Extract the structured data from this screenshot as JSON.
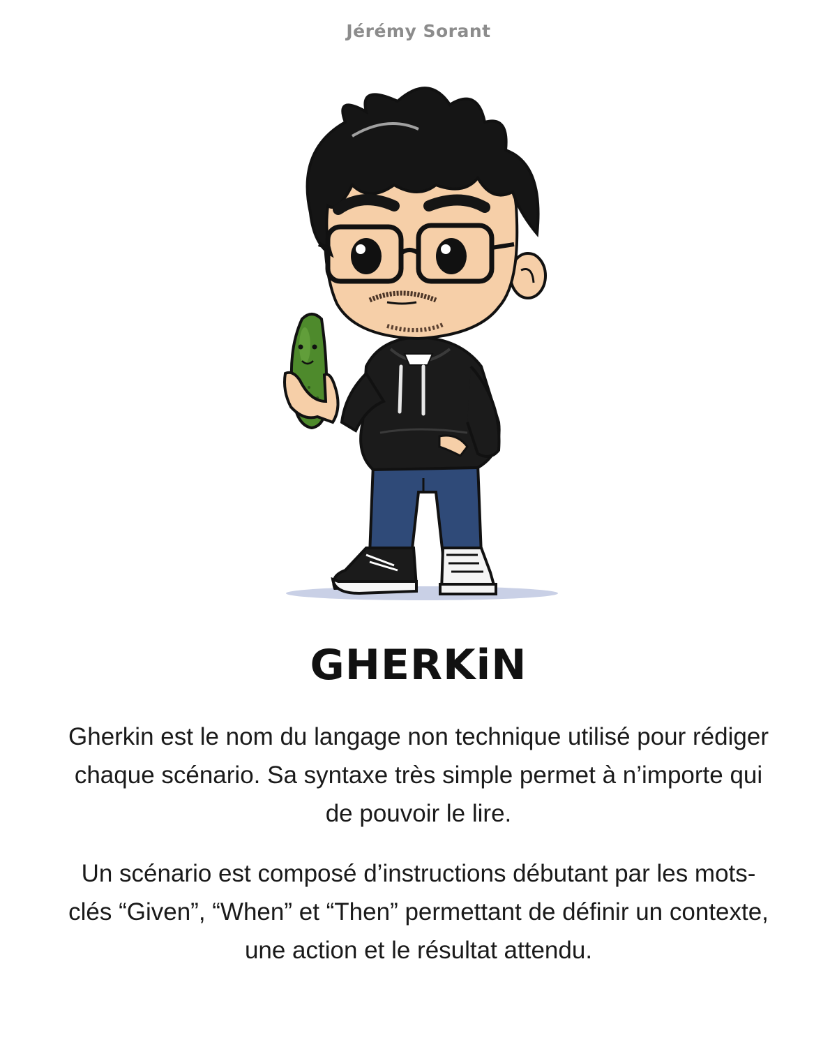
{
  "header": {
    "author": "Jérémy Sorant"
  },
  "illustration": {
    "subject": "cartoon-man-holding-pickle",
    "colors": {
      "hair": "#151515",
      "skin": "#f6cfa8",
      "hoodie": "#1b1b1b",
      "jeans": "#2f4a78",
      "pickle": "#4e8a2c",
      "shadow": "#c9d0e6"
    }
  },
  "content": {
    "title": "GHERKiN",
    "paragraph_1": "Gherkin est le nom du langage non technique utilisé pour rédiger chaque scénario. Sa syntaxe très simple permet à n’importe qui de pouvoir le lire.",
    "paragraph_2": "Un scénario est composé d’instructions débutant par les mots-clés “Given”, “When” et “Then” permettant de définir un contexte, une action et le résultat attendu."
  }
}
